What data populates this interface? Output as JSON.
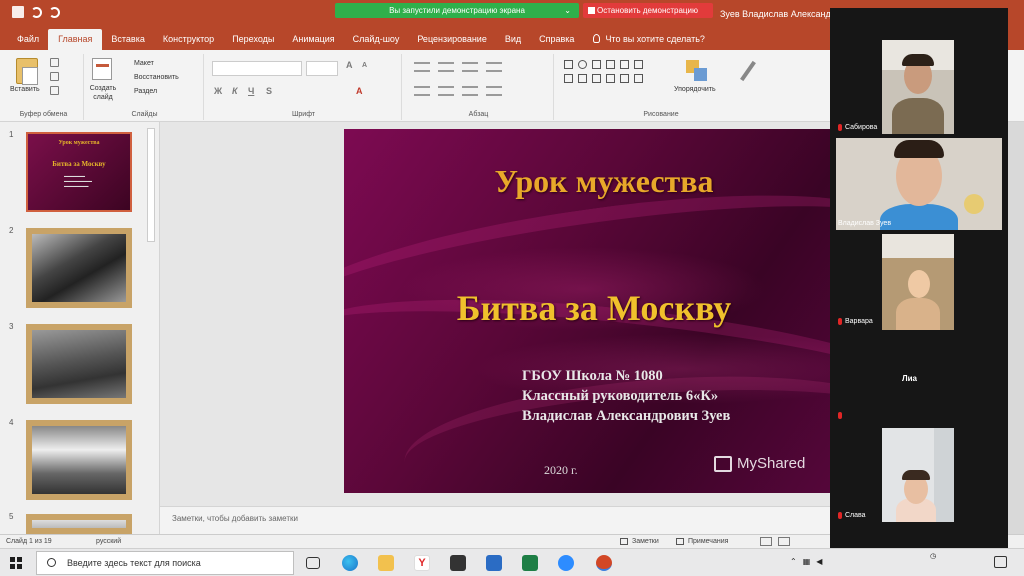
{
  "titlebar": {
    "qat_text": "",
    "share_banner": "Вы запустили демонстрацию экрана",
    "stop_share": "Остановить демонстрацию",
    "account": "Зуев Владислав Александрович"
  },
  "ribbon_tabs": [
    "Файл",
    "Главная",
    "Вставка",
    "Конструктор",
    "Переходы",
    "Анимация",
    "Слайд-шоу",
    "Рецензирование",
    "Вид",
    "Справка"
  ],
  "tell_me": "Что вы хотите сделать?",
  "ribbon": {
    "paste": "Вставить",
    "clipboard": "Буфер обмена",
    "new_slide": "Создать слайд",
    "layout": "Макет",
    "reset": "Восстановить",
    "section": "Раздел",
    "slides": "Слайды",
    "font": "Шрифт",
    "paragraph": "Абзац",
    "arrange": "Упорядочить",
    "drawing": "Рисование"
  },
  "thumbnails": [
    {
      "num": "1",
      "kind": "title",
      "t1": "Урок мужества",
      "t2": "Битва за Москву"
    },
    {
      "num": "2",
      "kind": "photo"
    },
    {
      "num": "3",
      "kind": "photo"
    },
    {
      "num": "4",
      "kind": "photo"
    },
    {
      "num": "5",
      "kind": "photo"
    }
  ],
  "slide": {
    "title": "Урок мужества",
    "subtitle": "Битва за Москву",
    "school": "ГБОУ Школа № 1080",
    "role": "Классный руководитель 6«К»",
    "teacher": "Владислав Александрович Зуев",
    "year": "2020 г.",
    "watermark": "MyShared"
  },
  "notes_placeholder": "Заметки, чтобы добавить заметки",
  "status": {
    "slide_counter": "Слайд 1 из 19",
    "language": "русский",
    "notes": "Заметки",
    "comments": "Примечания"
  },
  "participants": [
    {
      "name": "Сабирова"
    },
    {
      "name": "Владислав Зуев"
    },
    {
      "name": "Варвара"
    },
    {
      "name": "Лиа"
    },
    {
      "name": "Слава"
    }
  ],
  "taskbar": {
    "search_placeholder": "Введите здесь текст для поиска"
  },
  "colors": {
    "ppt_accent": "#b7472a",
    "share_green": "#2fb04b",
    "stop_red": "#e23b3b",
    "slide_bg": "#6a0844",
    "slide_title": "#e8a82a"
  }
}
